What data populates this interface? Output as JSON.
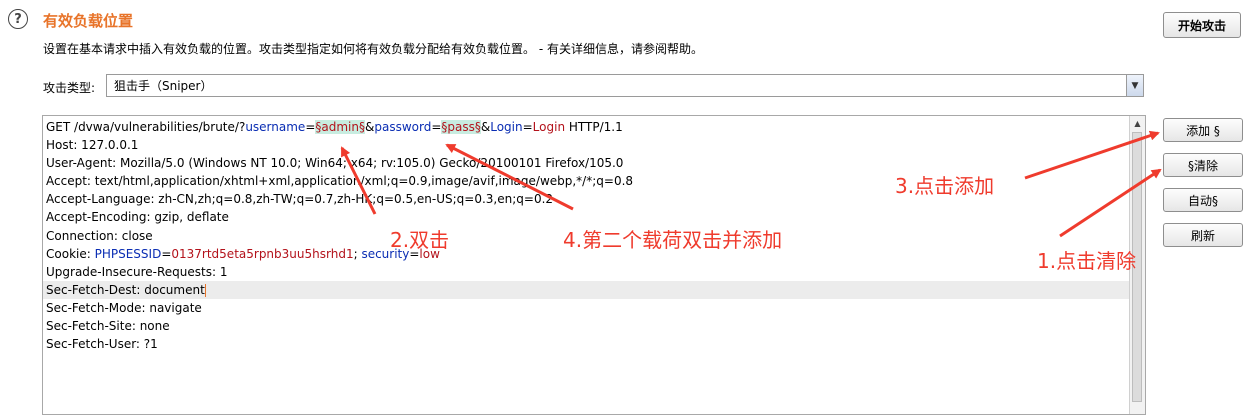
{
  "header": {
    "title": "有效负载位置",
    "description": "设置在基本请求中插入有效负载的位置。攻击类型指定如何将有效负载分配给有效负载位置。 - 有关详细信息，请参阅帮助。",
    "start_attack": "开始攻击"
  },
  "attack_type": {
    "label": "攻击类型:",
    "value": "狙击手（Sniper）"
  },
  "side_buttons": {
    "add": "添加 §",
    "clear": "§清除",
    "auto": "自动§",
    "refresh": "刷新"
  },
  "request": {
    "line1": {
      "prefix": "GET /dvwa/vulnerabilities/brute/?",
      "p1_name": "username",
      "eq1": "=",
      "p1_value": "§admin§",
      "amp1": "&",
      "p2_name": "password",
      "eq2": "=",
      "p2_value": "§pass§",
      "amp2": "&",
      "p3_name": "Login",
      "eq3": "=",
      "p3_value": "Login",
      "suffix": " HTTP/1.1"
    },
    "host": "Host: 127.0.0.1",
    "user_agent": "User-Agent: Mozilla/5.0 (Windows NT 10.0; Win64; x64; rv:105.0) Gecko/20100101 Firefox/105.0",
    "accept": "Accept: text/html,application/xhtml+xml,application/xml;q=0.9,image/avif,image/webp,*/*;q=0.8",
    "accept_language": "Accept-Language: zh-CN,zh;q=0.8,zh-TW;q=0.7,zh-HK;q=0.5,en-US;q=0.3,en;q=0.2",
    "accept_encoding": "Accept-Encoding: gzip, deflate",
    "connection": "Connection: close",
    "cookie": {
      "prefix": "Cookie: ",
      "k1": "PHPSESSID",
      "eq1": "=",
      "v1": "0137rtd5eta5rpnb3uu5hsrhd1",
      "sep": "; ",
      "k2": "security",
      "eq2": "=",
      "v2": "low"
    },
    "upgrade": "Upgrade-Insecure-Requests: 1",
    "sec_fetch_dest": "Sec-Fetch-Dest: document",
    "sec_fetch_mode": "Sec-Fetch-Mode: navigate",
    "sec_fetch_site": "Sec-Fetch-Site: none",
    "sec_fetch_user": "Sec-Fetch-User: ?1"
  },
  "annotations": {
    "step1": "1.点击清除",
    "step2": "2.双击",
    "step3": "3.点击添加",
    "step4": "4.第二个载荷双击并添加"
  },
  "colors": {
    "title_orange": "#e8742a",
    "annotation_red": "#ef3b2d",
    "param_blue": "#0a2db3",
    "value_red": "#b3121b",
    "payload_highlight": "#c8ece0"
  },
  "icons": {
    "help": "question-circle-icon",
    "dropdown": "chevron-down-icon",
    "scroll_up": "arrow-up-icon"
  }
}
